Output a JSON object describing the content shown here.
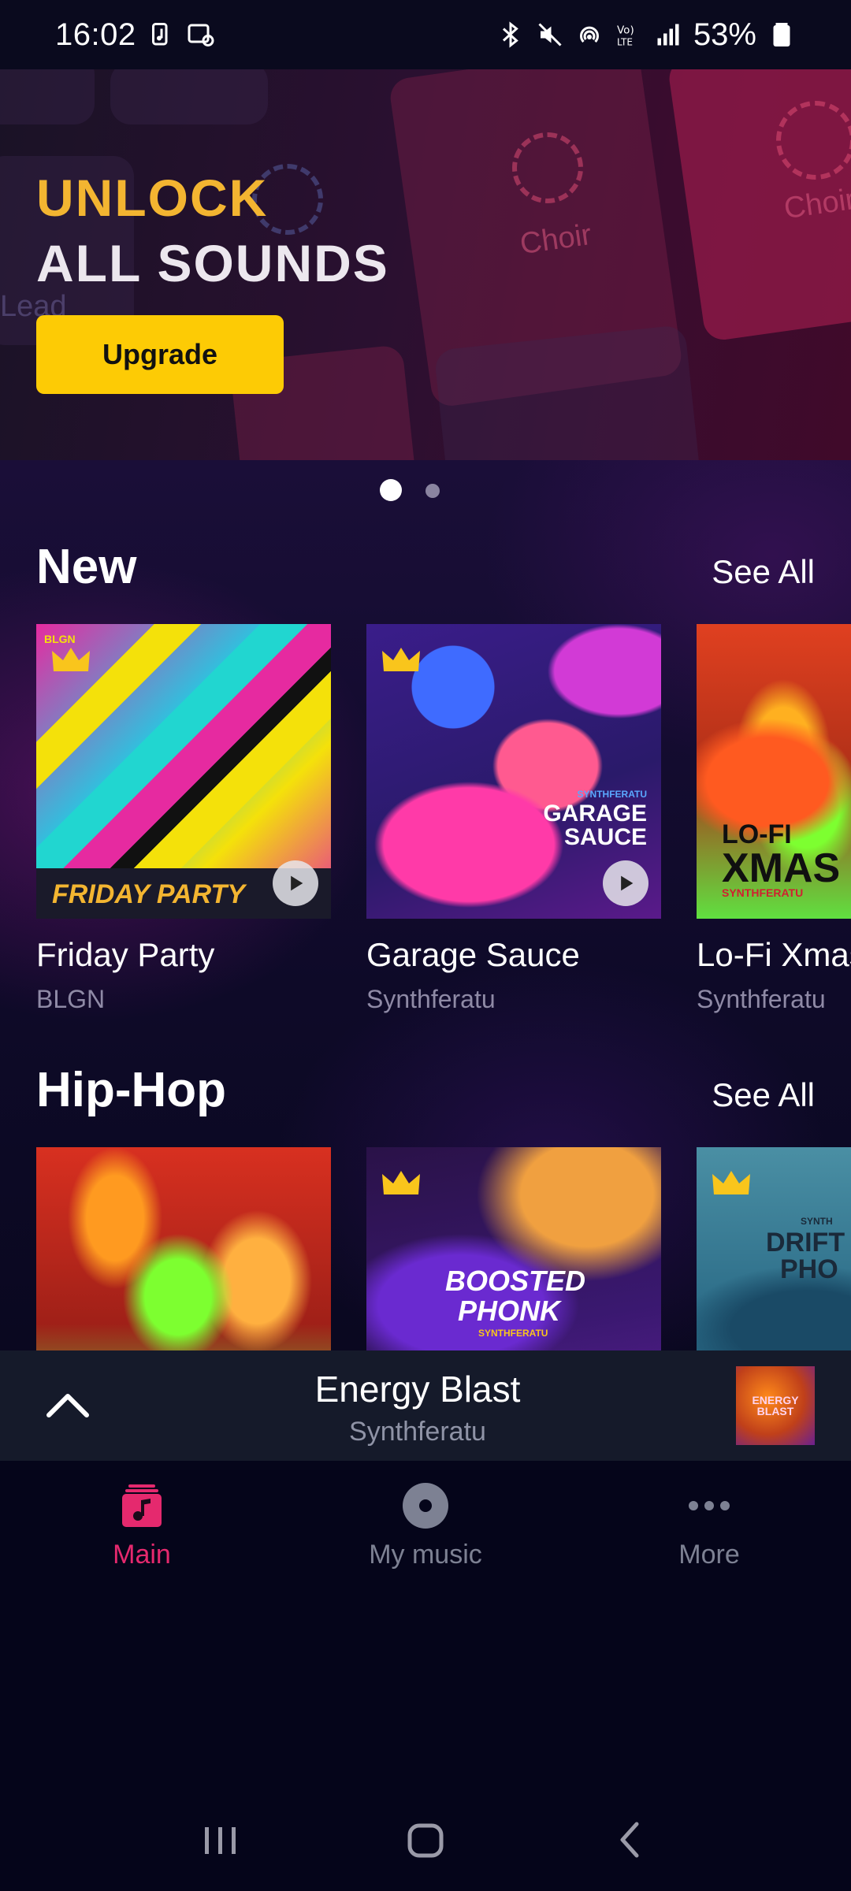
{
  "status_bar": {
    "time": "16:02",
    "battery": "53%",
    "icons": [
      "music-note-icon",
      "screen-share-icon",
      "bluetooth-icon",
      "mute-icon",
      "hotspot-icon",
      "volte-icon",
      "signal-icon",
      "battery-icon"
    ]
  },
  "banner": {
    "line1": "UNLOCK",
    "line2": "ALL SOUNDS",
    "button_label": "Upgrade",
    "pad_labels": [
      "Choir",
      "Choir",
      "Lead"
    ],
    "page_index": 1,
    "page_count": 2
  },
  "sections": [
    {
      "title": "New",
      "see_all": "See All",
      "items": [
        {
          "title": "Friday Party",
          "artist": "BLGN",
          "cover_text": "FRIDAY PARTY",
          "cover_brand": "BLGN",
          "premium": true
        },
        {
          "title": "Garage Sauce",
          "artist": "Synthferatu",
          "cover_text_line1": "GARAGE",
          "cover_text_line2": "SAUCE",
          "cover_brand": "SYNTHFERATU",
          "premium": true
        },
        {
          "title": "Lo-Fi Xmas",
          "artist": "Synthferatu",
          "cover_text_line1": "LO-FI",
          "cover_text_line2": "XMAS",
          "cover_brand": "SYNTHFERATU",
          "premium": false
        }
      ]
    },
    {
      "title": "Hip-Hop",
      "see_all": "See All",
      "items": [
        {
          "cover": "cones",
          "premium": false
        },
        {
          "cover_text_line1": "BOOSTED",
          "cover_text_line2": "PHONK",
          "cover_brand": "SYNTHFERATU",
          "premium": true
        },
        {
          "cover_text_line1": "DRIFT",
          "cover_text_line2": "PHO",
          "cover_brand": "SYNTH",
          "premium": true
        }
      ]
    }
  ],
  "mini_player": {
    "title": "Energy Blast",
    "artist": "Synthferatu",
    "art_text": "ENERGY BLAST"
  },
  "bottom_nav": [
    {
      "label": "Main",
      "icon": "music-note-icon",
      "active": true
    },
    {
      "label": "My music",
      "icon": "disc-icon",
      "active": false
    },
    {
      "label": "More",
      "icon": "more-dots-icon",
      "active": false
    }
  ],
  "colors": {
    "accent": "#e5296e",
    "upgrade": "#fdcb05",
    "unlock": "#f3b531",
    "crown": "#f9c51c"
  }
}
